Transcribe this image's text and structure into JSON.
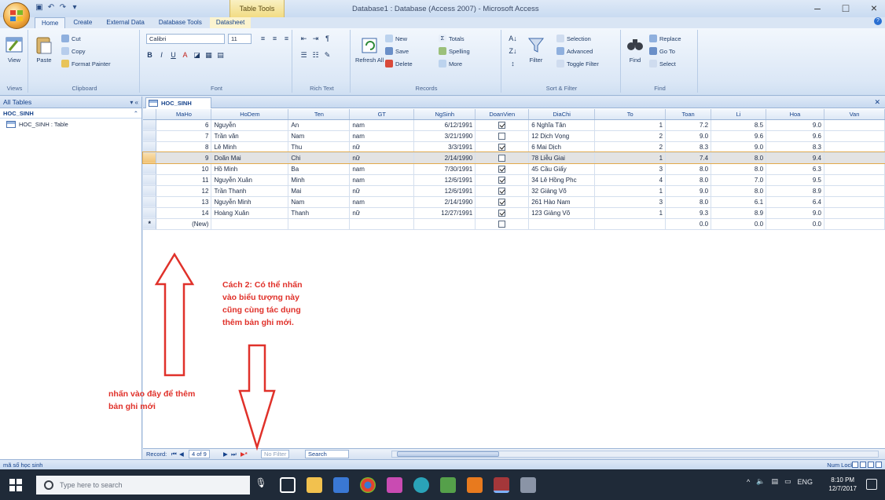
{
  "window": {
    "title": "Database1 : Database (Access 2007) - Microsoft Access",
    "context_tab_title": "Table Tools",
    "controls": [
      "–",
      "□",
      "×"
    ]
  },
  "ribbon_tabs": [
    {
      "label": "Home",
      "active": true
    },
    {
      "label": "Create"
    },
    {
      "label": "External Data"
    },
    {
      "label": "Database Tools"
    },
    {
      "label": "Datasheet",
      "context": true
    }
  ],
  "ribbon": {
    "views": {
      "view": "View",
      "label": "Views"
    },
    "clipboard": {
      "paste": "Paste",
      "cut": "Cut",
      "copy": "Copy",
      "format_painter": "Format Painter",
      "label": "Clipboard"
    },
    "font": {
      "name": "Calibri",
      "size": "11",
      "label": "Font"
    },
    "rich_text": {
      "label": "Rich Text"
    },
    "records": {
      "refresh": "Refresh All",
      "new": "New",
      "save": "Save",
      "delete": "Delete",
      "totals": "Totals",
      "spelling": "Spelling",
      "more": "More",
      "label": "Records"
    },
    "sort_filter": {
      "filter": "Filter",
      "selection": "Selection",
      "advanced": "Advanced",
      "toggle": "Toggle Filter",
      "label": "Sort & Filter"
    },
    "find": {
      "find": "Find",
      "replace": "Replace",
      "goto": "Go To",
      "select": "Select",
      "label": "Find"
    }
  },
  "nav_pane": {
    "header": "All Tables",
    "group": "HOC_SINH",
    "items": [
      "HOC_SINH : Table"
    ]
  },
  "document": {
    "tab": "HOC_SINH"
  },
  "table": {
    "columns": [
      "MaHo",
      "HoDem",
      "Ten",
      "GT",
      "NgSinh",
      "DoanVien",
      "DiaChi",
      "To",
      "Toan",
      "Li",
      "Hoa",
      "Van"
    ],
    "rows": [
      {
        "id": "6",
        "hodem": "Nguyễn",
        "ten": "An",
        "gt": "nam",
        "ngsinh": "6/12/1991",
        "doanvien": true,
        "diachi": "6 Nghĩa Tân",
        "to": "1",
        "toan": "7.2",
        "li": "8.5",
        "hoa": "9.0"
      },
      {
        "id": "7",
        "hodem": "Trần văn",
        "ten": "Nam",
        "gt": "nam",
        "ngsinh": "3/21/1990",
        "doanvien": false,
        "diachi": "12 Dịch Vọng",
        "to": "2",
        "toan": "9.0",
        "li": "9.6",
        "hoa": "9.6"
      },
      {
        "id": "8",
        "hodem": "Lê Minh",
        "ten": "Thu",
        "gt": "nữ",
        "ngsinh": "3/3/1991",
        "doanvien": true,
        "diachi": "6 Mai Dịch",
        "to": "2",
        "toan": "8.3",
        "li": "9.0",
        "hoa": "8.3"
      },
      {
        "id": "9",
        "hodem": "Doãn Mai",
        "ten": "Chi",
        "gt": "nữ",
        "ngsinh": "2/14/1990",
        "doanvien": false,
        "diachi": "78 Liễu Giai",
        "to": "1",
        "toan": "7.4",
        "li": "8.0",
        "hoa": "9.4",
        "current": true
      },
      {
        "id": "10",
        "hodem": "Hồ Minh",
        "ten": "Ba",
        "gt": "nam",
        "ngsinh": "7/30/1991",
        "doanvien": true,
        "diachi": "45 Cầu Giấy",
        "to": "3",
        "toan": "8.0",
        "li": "8.0",
        "hoa": "6.3"
      },
      {
        "id": "11",
        "hodem": "Nguyễn Xuân",
        "ten": "Minh",
        "gt": "nam",
        "ngsinh": "12/6/1991",
        "doanvien": true,
        "diachi": "34 Lê Hồng Phc",
        "to": "4",
        "toan": "8.0",
        "li": "7.0",
        "hoa": "9.5"
      },
      {
        "id": "12",
        "hodem": "Trần Thanh",
        "ten": "Mai",
        "gt": "nữ",
        "ngsinh": "12/6/1991",
        "doanvien": true,
        "diachi": "32 Giảng Võ",
        "to": "1",
        "toan": "9.0",
        "li": "8.0",
        "hoa": "8.9"
      },
      {
        "id": "13",
        "hodem": "Nguyễn Minh",
        "ten": "Nam",
        "gt": "nam",
        "ngsinh": "2/14/1990",
        "doanvien": true,
        "diachi": "261 Hào Nam",
        "to": "3",
        "toan": "8.0",
        "li": "6.1",
        "hoa": "6.4"
      },
      {
        "id": "14",
        "hodem": "Hoàng Xuân",
        "ten": "Thanh",
        "gt": "nữ",
        "ngsinh": "12/27/1991",
        "doanvien": true,
        "diachi": "123 Giảng Võ",
        "to": "1",
        "toan": "9.3",
        "li": "8.9",
        "hoa": "9.0"
      }
    ],
    "new_row": {
      "marker": "*",
      "label": "(New)",
      "toan": "0.0",
      "li": "0.0",
      "hoa": "0.0"
    }
  },
  "record_nav": {
    "label": "Record:",
    "position": "4 of 9",
    "filter": "No Filter",
    "search": "Search"
  },
  "status": {
    "left": "mã số học sinh",
    "right": "Num Lock"
  },
  "taskbar": {
    "search_placeholder": "Type here to search",
    "lang": "ENG",
    "time": "8:10 PM",
    "date": "12/7/2017"
  },
  "annotations": {
    "method2": [
      "Cách 2: Có thể nhấn",
      "vào biểu tượng này",
      "cũng cùng tác dụng",
      "thêm bản ghi mới."
    ],
    "click_here": [
      "nhấn vào đây để thêm",
      "bản ghi mới"
    ]
  },
  "colors": {
    "annotation": "#e0312a",
    "current_row_marker": "#f0c273",
    "accent": "#15428b"
  }
}
